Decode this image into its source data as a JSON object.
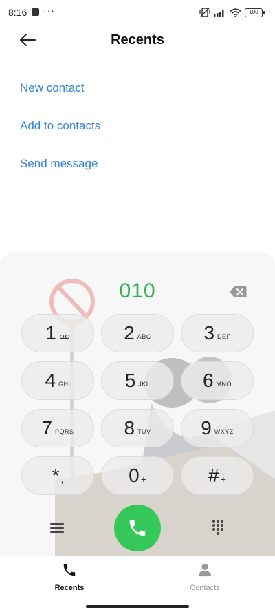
{
  "status": {
    "time": "8:16",
    "dots": "···",
    "battery": "100"
  },
  "header": {
    "title": "Recents"
  },
  "actions": [
    "New contact",
    "Add to contacts",
    "Send message"
  ],
  "dialer": {
    "number": "010",
    "keys": [
      {
        "digit": "1",
        "letters": "",
        "sym": ""
      },
      {
        "digit": "2",
        "letters": "ABC",
        "sym": ""
      },
      {
        "digit": "3",
        "letters": "DEF",
        "sym": ""
      },
      {
        "digit": "4",
        "letters": "GHI",
        "sym": ""
      },
      {
        "digit": "5",
        "letters": "JKL",
        "sym": ""
      },
      {
        "digit": "6",
        "letters": "MNO",
        "sym": ""
      },
      {
        "digit": "7",
        "letters": "PQRS",
        "sym": ""
      },
      {
        "digit": "8",
        "letters": "TUV",
        "sym": ""
      },
      {
        "digit": "9",
        "letters": "WXYZ",
        "sym": ""
      },
      {
        "digit": "*",
        "letters": "",
        "sym": ","
      },
      {
        "digit": "0",
        "letters": "",
        "sym": "+"
      },
      {
        "digit": "#",
        "letters": "",
        "sym": "+"
      }
    ]
  },
  "nav": {
    "recents": "Recents",
    "contacts": "Contacts"
  },
  "colors": {
    "accent": "#3482d9",
    "number": "#2bb34e",
    "call": "#34c759"
  }
}
